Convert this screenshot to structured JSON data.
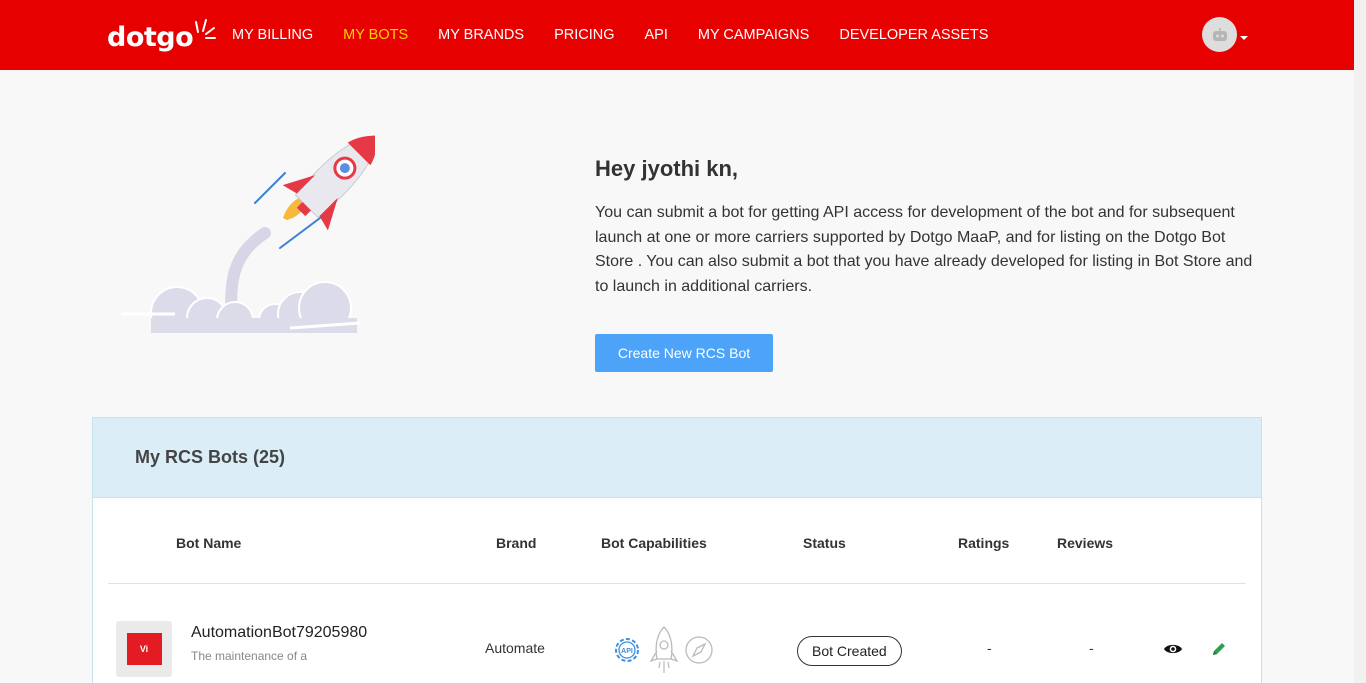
{
  "header": {
    "logo_text": "dotgo",
    "nav": [
      {
        "label": "MY BILLING",
        "active": false
      },
      {
        "label": "MY BOTS",
        "active": true
      },
      {
        "label": "MY BRANDS",
        "active": false
      },
      {
        "label": "PRICING",
        "active": false
      },
      {
        "label": "API",
        "active": false
      },
      {
        "label": "MY CAMPAIGNS",
        "active": false
      },
      {
        "label": "DEVELOPER ASSETS",
        "active": false
      }
    ],
    "avatar_icon": "robot-icon",
    "colors": {
      "bar": "#e60000",
      "active_nav": "#ffd200"
    }
  },
  "hero": {
    "greeting": "Hey jyothi kn,",
    "text": "You can submit a bot for getting API access for development of the bot and for subsequent launch at one or more carriers supported by Dotgo MaaP, and for listing on the Dotgo Bot Store . You can also submit a bot that you have already developed for listing in Bot Store and to launch in additional carriers.",
    "create_button": "Create New RCS Bot",
    "illustration": "rocket-launch-illustration"
  },
  "bots": {
    "title": "My RCS Bots (25)",
    "columns": [
      "Bot Name",
      "Brand",
      "Bot Capabilities",
      "Status",
      "Ratings",
      "Reviews"
    ],
    "rows": [
      {
        "logo_text": "Vi",
        "name": "AutomationBot79205980",
        "description": "The maintenance of a",
        "brand": "Automate",
        "capabilities": [
          "api-gear-icon",
          "rocket-icon",
          "compass-icon"
        ],
        "status": "Bot Created",
        "rating": "-",
        "reviews": "-"
      }
    ]
  }
}
